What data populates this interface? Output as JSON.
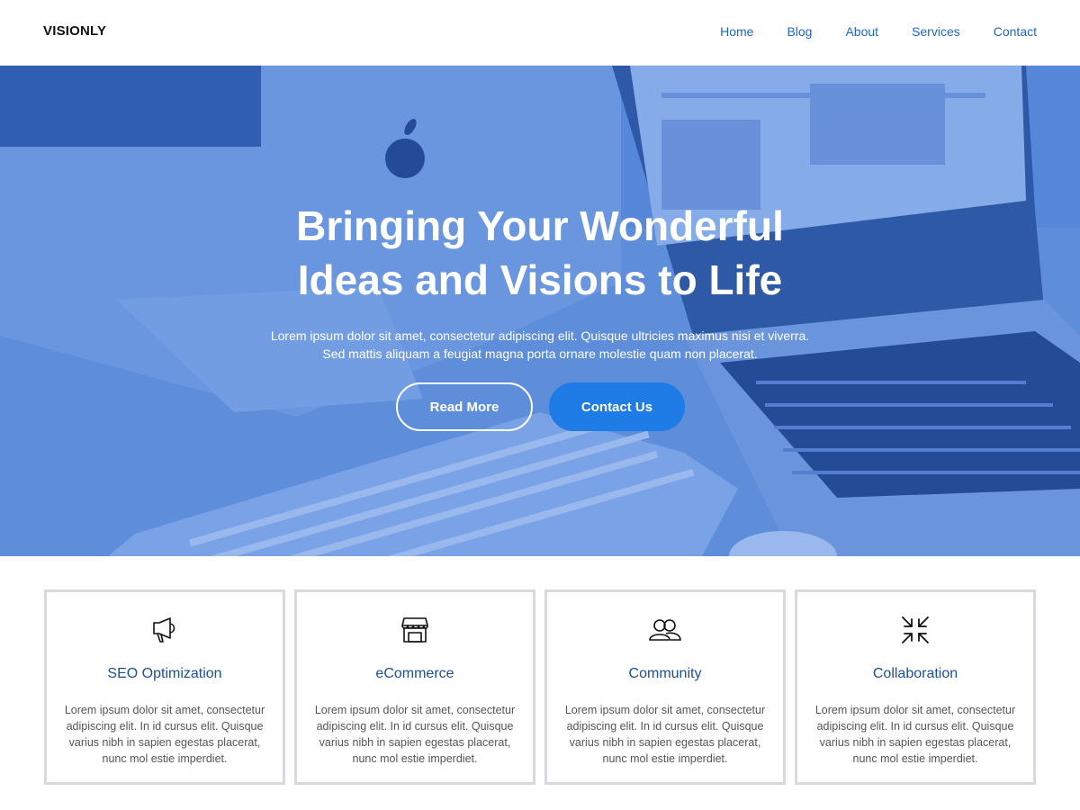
{
  "header": {
    "logo": "VISIONLY",
    "nav": [
      {
        "label": "Home"
      },
      {
        "label": "Blog"
      },
      {
        "label": "About"
      },
      {
        "label": "Services"
      },
      {
        "label": "Contact"
      }
    ]
  },
  "hero": {
    "title_line1": "Bringing Your Wonderful",
    "title_line2": "Ideas and Visions to Life",
    "subtitle_line1": "Lorem ipsum dolor sit amet, consectetur adipiscing elit. Quisque ultricies maximus nisi et viverra.",
    "subtitle_line2": "Sed mattis aliquam a feugiat magna porta ornare molestie quam non placerat.",
    "read_more_label": "Read More",
    "contact_label": "Contact Us",
    "overlay_color": "#3b6fd0",
    "accent_color": "#1f7be6"
  },
  "features": [
    {
      "icon": "megaphone-icon",
      "title": "SEO Optimization",
      "text": "Lorem ipsum dolor sit amet, consectetur adipiscing elit. In id cursus elit. Quisque varius nibh in sapien egestas placerat, nunc mol estie imperdiet."
    },
    {
      "icon": "storefront-icon",
      "title": "eCommerce",
      "text": "Lorem ipsum dolor sit amet, consectetur adipiscing elit. In id cursus elit. Quisque varius nibh in sapien egestas placerat, nunc mol estie imperdiet."
    },
    {
      "icon": "users-icon",
      "title": "Community",
      "text": "Lorem ipsum dolor sit amet, consectetur adipiscing elit. In id cursus elit. Quisque varius nibh in sapien egestas placerat, nunc mol estie imperdiet."
    },
    {
      "icon": "collapse-arrows-icon",
      "title": "Collaboration",
      "text": "Lorem ipsum dolor sit amet, consectetur adipiscing elit. In id cursus elit. Quisque varius nibh in sapien egestas placerat, nunc mol estie imperdiet."
    }
  ]
}
